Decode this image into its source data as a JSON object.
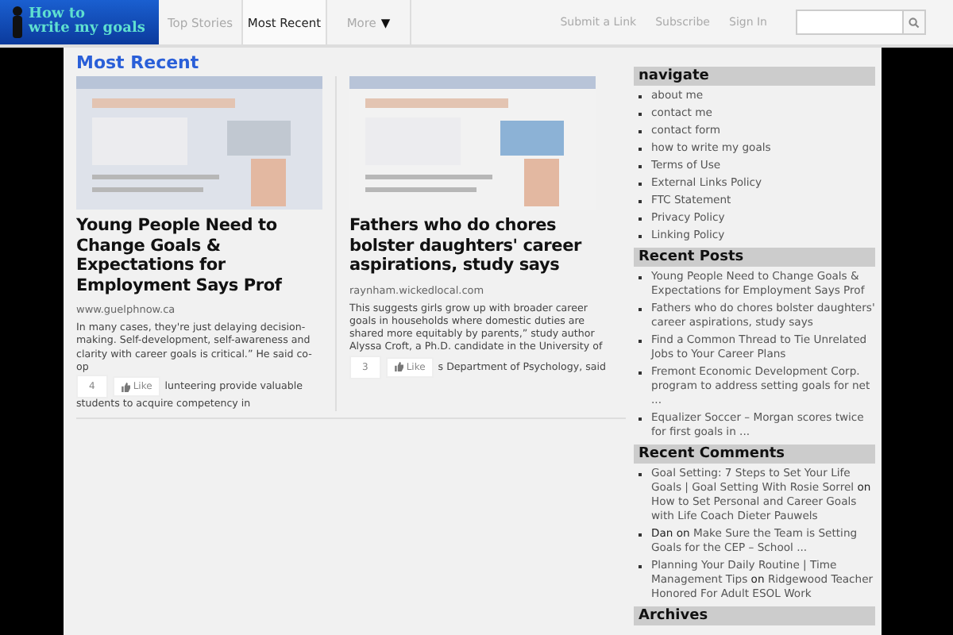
{
  "logo": {
    "lines": [
      "How to",
      "write my goals"
    ]
  },
  "tabs": [
    {
      "label": "Top Stories",
      "selected": false
    },
    {
      "label": "Most Recent",
      "selected": true
    },
    {
      "label": "More",
      "selected": false,
      "caret": "▼"
    }
  ],
  "top_links": [
    "Submit a Link",
    "Subscribe",
    "Sign In"
  ],
  "main": {
    "heading": "Most Recent",
    "articles": [
      {
        "title": "Young People Need to Change Goals & Expectations for Employment Says Prof",
        "source": "www.guelphnow.ca",
        "excerpt": "In many cases, they're just delaying decision-making. Self-development, self-awareness and clarity with career goals is critical.” He said co-op",
        "like_count": "4",
        "like_label": "Like",
        "after_like": "lunteering provide valuable",
        "tail": "students to acquire competency in"
      },
      {
        "title": "Fathers who do chores bolster daughters' career aspirations, study says",
        "source": "raynham.wickedlocal.com",
        "excerpt": "This suggests girls grow up with broader career goals in households where domestic duties are shared more equitably by parents,” study author Alyssa Croft, a Ph.D. candidate in the University of",
        "like_count": "3",
        "like_label": "Like",
        "after_like": "s Department of Psychology, said"
      }
    ]
  },
  "sidebar": [
    {
      "title": "navigate",
      "kind": "links",
      "items": [
        "about me",
        "contact me",
        "contact form",
        "how to write my goals",
        "Terms of Use",
        "External Links Policy",
        "FTC Statement",
        "Privacy Policy",
        "Linking Policy"
      ]
    },
    {
      "title": "Recent Posts",
      "kind": "links",
      "items": [
        "Young People Need to Change Goals & Expectations for Employment Says Prof",
        "Fathers who do chores bolster daughters' career aspirations, study says",
        "Find a Common Thread to Tie Unrelated Jobs to Your Career Plans",
        "Fremont Economic Development Corp. program to address setting goals for net ...",
        "Equalizer Soccer – Morgan scores twice for first goals in ..."
      ]
    },
    {
      "title": "Recent Comments",
      "kind": "comments",
      "items": [
        {
          "author": "Goal Setting: 7 Steps to Set Your Life Goals | Goal Setting With Rosie Sorrel",
          "author_link": true,
          "joiner": "on",
          "post": "How to Set Personal and Career Goals with Life Coach Dieter Pauwels"
        },
        {
          "author": "Dan",
          "author_link": false,
          "joiner": "on",
          "post": "Make Sure the Team is Setting Goals for the CEP – School ..."
        },
        {
          "author": "Planning Your Daily Routine | Time Management Tips",
          "author_link": true,
          "joiner": "on",
          "post": "Ridgewood Teacher Honored For Adult ESOL Work"
        }
      ]
    },
    {
      "title": "Archives"
    }
  ]
}
